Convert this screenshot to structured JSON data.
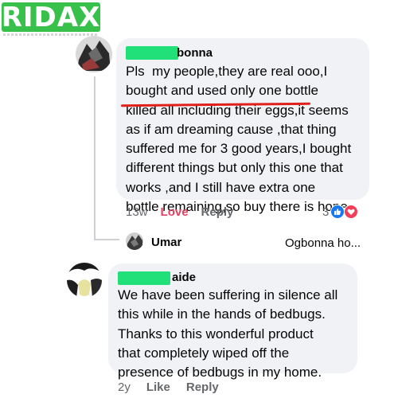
{
  "brand": {
    "logo_text": "RIDAX",
    "logo_color": "#37c14b"
  },
  "comment1": {
    "name_suffix": "bonna",
    "text": "Pls  my people,they are real ooo,I\nbought and used only one bottle\nkilled all including their eggs,it seems\nas if am dreaming cause ,that thing\nsuffered me for 3 good years,I bought\ndifferent things but only this one that\nworks ,and I still have extra one\nbottle remaining,so buy there is hope",
    "time": "13w",
    "love_label": "Love",
    "reply_label": "Reply",
    "reaction_count": "3",
    "reactions": [
      "like-icon",
      "love-icon"
    ]
  },
  "reply_preview": {
    "name": "Umar",
    "preview": "Ogbonna ho..."
  },
  "comment2": {
    "name_suffix": "aide",
    "text": "We have been suffering in silence all\nthis while in the hands of bedbugs.\nThanks to this wonderful product\nthat completely wiped off the\npresence of bedbugs in my home.",
    "time": "2y",
    "like_label": "Like",
    "reply_label": "Reply"
  },
  "colors": {
    "bubble": "#f0f2f5",
    "name_censor": "#21e07a",
    "underline": "#e0201b",
    "love": "#e4405f",
    "like_icon": "#1877f2"
  }
}
